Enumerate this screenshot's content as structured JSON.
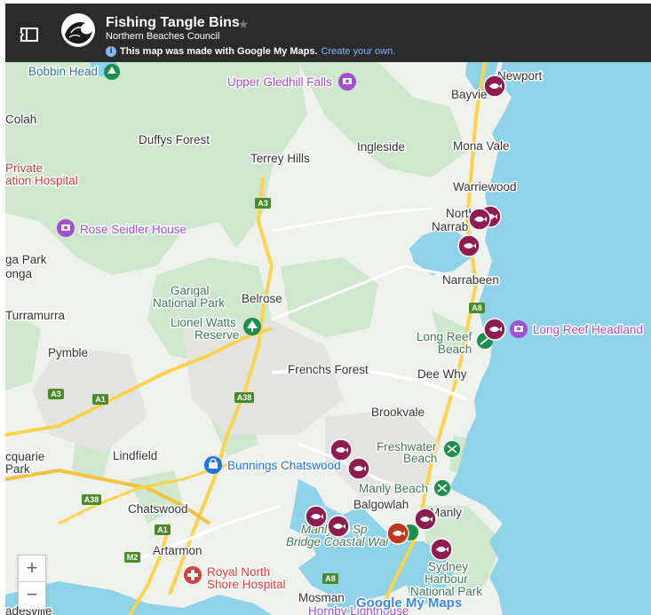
{
  "header": {
    "title": "Fishing Tangle Bins",
    "subtitle": "Northern Beaches Council",
    "info_text": "This map was made with Google My Maps.",
    "info_link": "Create your own."
  },
  "map": {
    "places": {
      "newport": "Newport",
      "bayview": "Bayvie",
      "bobbin_head": "Bobbin Head",
      "colah": "Colah",
      "duffys_forest": "Duffys Forest",
      "ingleside": "Ingleside",
      "mona_vale": "Mona Vale",
      "private1": "Private",
      "private2": "ation Hospital",
      "terrey_hills": "Terrey Hills",
      "warriewood": "Warriewood",
      "north_narrabeen1": "North",
      "north_narrabeen2": "Narrab",
      "ga_park": "ga Park",
      "onga": "onga",
      "narrabeen": "Narrabeen",
      "garigal1": "Garigal",
      "garigal2": "National Park",
      "belrose": "Belrose",
      "turramurra": "Turramurra",
      "lionel1": "Lionel Watts",
      "lionel2": "Reserve",
      "long_reef1": "Long Reef",
      "long_reef2": "Beach",
      "pymble": "Pymble",
      "frenchs_forest": "Frenchs Forest",
      "dee_why": "Dee Why",
      "brookvale": "Brookvale",
      "freshwater1": "Freshwater",
      "freshwater2": "Beach",
      "lindfield": "Lindfield",
      "cquarie1": "cquarie",
      "cquarie2": "Park",
      "manly_beach": "Manly Beach",
      "balgowlah": "Balgowlah",
      "manly": "Manly",
      "chatswood": "Chatswood",
      "spit1": "Manly To Sp",
      "spit2": "Bridge Coastal Wal",
      "artarmon": "Artarmon",
      "sydney_harbour1": "Sydney",
      "sydney_harbour2": "Harbour",
      "sydney_harbour3": "National Park",
      "mosman": "Mosman",
      "adesville": "adesville",
      "hornby": "Hornby Lighthouse"
    },
    "pois": {
      "upper_gledhill": "Upper Gledhill Falls",
      "rose_seidler": "Rose Seidler House",
      "long_reef_headland": "Long Reef Headland",
      "bunnings": "Bunnings Chatswood",
      "royal_north1": "Royal North",
      "royal_north2": "Shore Hospital"
    },
    "roads": {
      "a3_top": "A3",
      "a3_left": "A3",
      "a8_narrabeen": "A8",
      "a1": "A1",
      "a38_mid": "A38",
      "a38_left": "A38",
      "a1_chatswood": "A1",
      "m2": "M2",
      "a8_mosman": "A8"
    },
    "watermark": "Google My Maps",
    "zoom_in": "+",
    "zoom_out": "−"
  },
  "colors": {
    "header_bg": "#2b2b2b",
    "water": "#8fd3e8",
    "park": "#cfe8cd",
    "marker_fish": "#8e1c4f",
    "marker_selected": "#c1361d",
    "poi_purple": "#a24fd0",
    "poi_green": "#1e8e4e",
    "poi_blue": "#1a73e8",
    "poi_red": "#d8403a",
    "link_blue": "#8ab4f8",
    "road_sign": "#4a8a2a"
  }
}
